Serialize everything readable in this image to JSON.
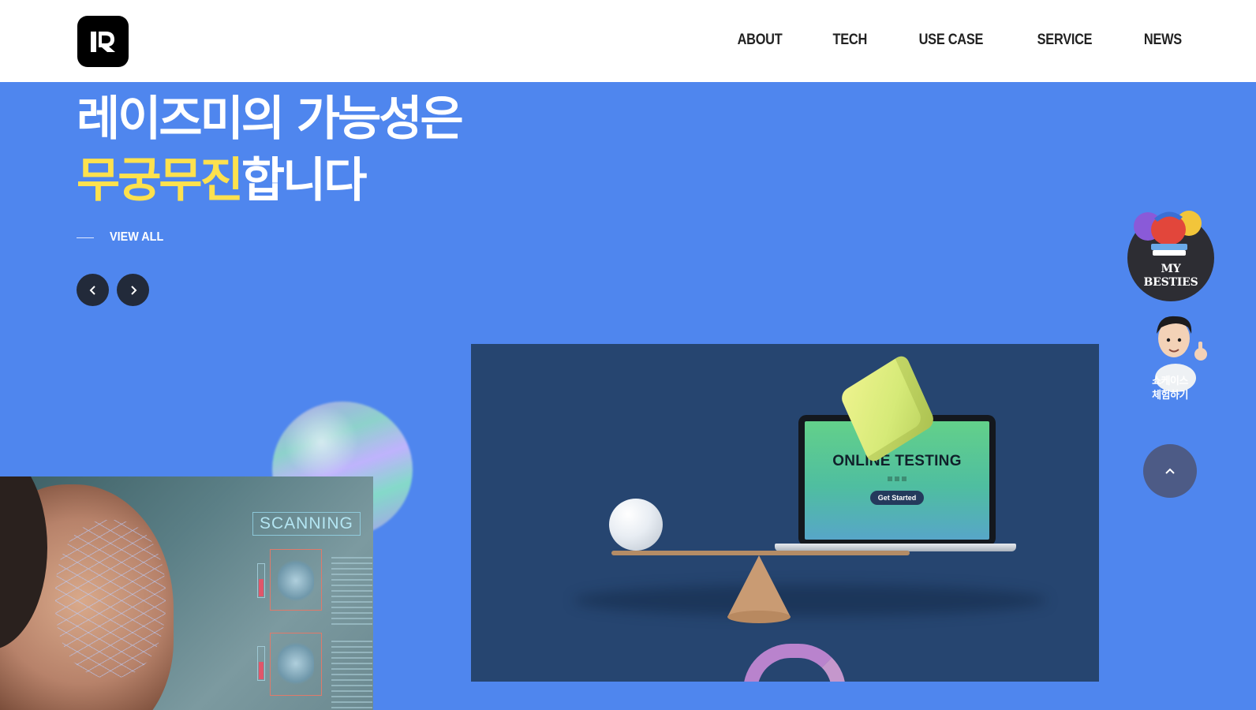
{
  "header": {
    "logo_icon": "raiseme-logo-icon",
    "nav": [
      {
        "label": "ABOUT"
      },
      {
        "label": "TECH"
      },
      {
        "label": "USE CASE"
      },
      {
        "label": "SERVICE"
      },
      {
        "label": "NEWS"
      }
    ]
  },
  "hero": {
    "headline_line1": "레이즈미의 가능성은",
    "headline_highlight": "무궁무진",
    "headline_line2_rest": "합니다",
    "view_all": "VIEW ALL",
    "prev_icon": "chevron-left-icon",
    "next_icon": "chevron-right-icon",
    "colors": {
      "background": "#4f86ee",
      "highlight": "#fde14e",
      "card": "#264570"
    }
  },
  "scanning_card": {
    "label": "SCANNING"
  },
  "laptop": {
    "title": "ONLINE TESTING",
    "button": "Get Started"
  },
  "floating": {
    "besties_line1": "MY",
    "besties_line2": "BESTIES",
    "showcase_line1": "쇼케이스",
    "showcase_line2": "체험하기",
    "top_icon": "chevron-up-icon"
  }
}
